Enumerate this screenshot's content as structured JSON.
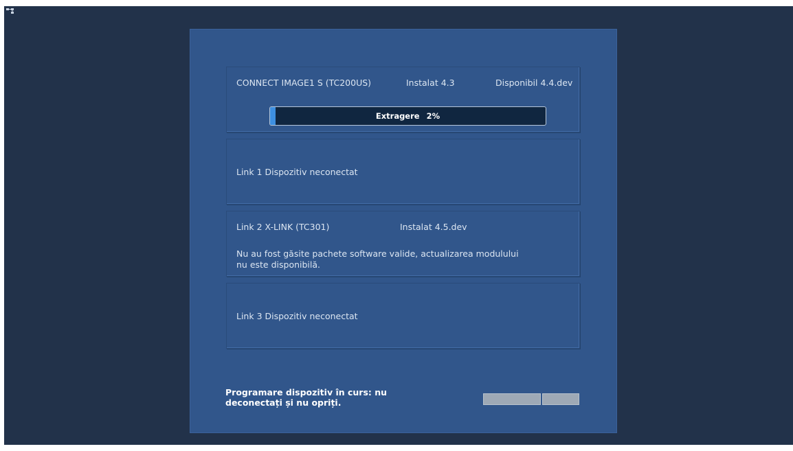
{
  "app": {
    "corner_icon": "network-icon"
  },
  "device": {
    "name": "CONNECT  IMAGE1 S (TC200US)",
    "installed": "Instalat 4.3",
    "available": "Disponibil 4.4.dev",
    "progress_label": "Extragere   2%",
    "progress_fraction": 0.02
  },
  "links": [
    {
      "title": "Link 1  Dispozitiv neconectat"
    },
    {
      "title": "Link 2   X-LINK (TC301)",
      "installed": "Instalat 4.5.dev",
      "message_line1": "Nu au fost găsite pachete software valide, actualizarea modulului",
      "message_line2": "nu este disponibilă."
    },
    {
      "title": "Link 3  Dispozitiv neconectat"
    }
  ],
  "footer": {
    "warning_line1": "Programare dispozitiv în curs: nu",
    "warning_line2": "deconectați și nu opriți.",
    "button1_label": "",
    "button2_label": ""
  }
}
